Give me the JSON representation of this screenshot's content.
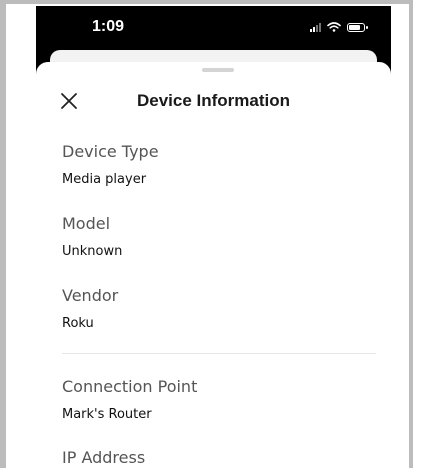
{
  "status_bar": {
    "time": "1:09",
    "signal_icon": "signal-bars-icon",
    "wifi_icon": "wifi-icon",
    "battery_icon": "battery-icon"
  },
  "sheet": {
    "title": "Device Information",
    "close_icon": "close-icon"
  },
  "fields": [
    {
      "label": "Device Type",
      "value": "Media player"
    },
    {
      "label": "Model",
      "value": "Unknown"
    },
    {
      "label": "Vendor",
      "value": "Roku"
    },
    {
      "label": "Connection Point",
      "value": "Mark's Router"
    },
    {
      "label": "IP Address",
      "value": ""
    }
  ],
  "colors": {
    "status_bg": "#000000",
    "sheet_bg": "#ffffff",
    "label": "#555555",
    "value": "#111111"
  }
}
